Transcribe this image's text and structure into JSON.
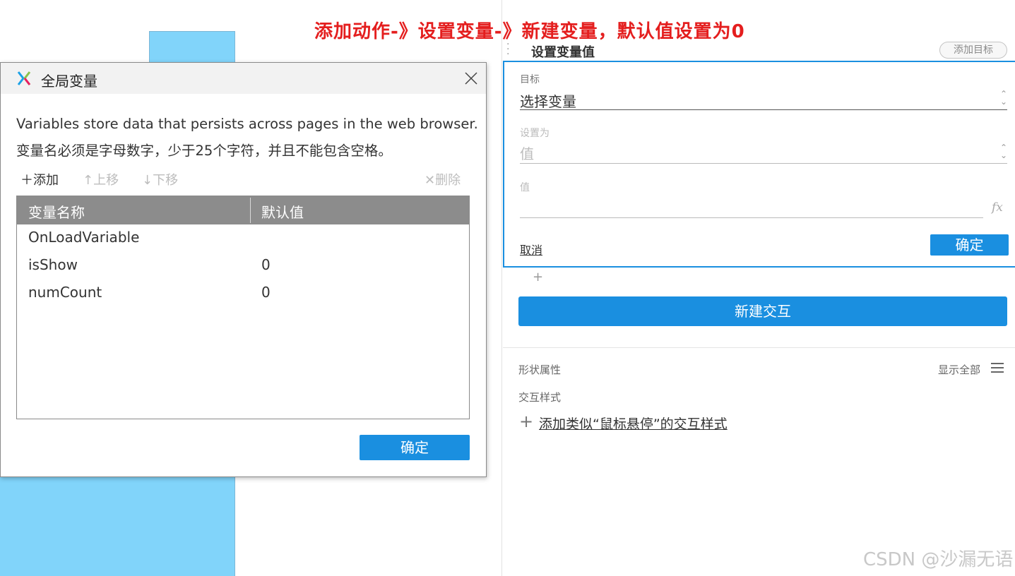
{
  "annotation": "添加动作-》设置变量-》新建变量，默认值设置为0",
  "dialog": {
    "title": "全局变量",
    "description_en": "Variables store data that persists across pages in the web browser.",
    "description_zh": "变量名必须是字母数字，少于25个字符，并且不能包含空格。",
    "toolbar": {
      "add": "＋添加",
      "move_up": "↑上移",
      "move_down": "↓下移",
      "delete": "✕删除"
    },
    "table": {
      "columns": [
        "变量名称",
        "默认值"
      ],
      "rows": [
        {
          "name": "OnLoadVariable",
          "default": ""
        },
        {
          "name": "isShow",
          "default": "0"
        },
        {
          "name": "numCount",
          "default": "0"
        }
      ]
    },
    "ok_label": "确定"
  },
  "action": {
    "title": "设置变量值",
    "add_target_label": "添加目标",
    "target_label": "目标",
    "target_value": "选择变量",
    "set_to_label": "设置为",
    "set_to_value": "值",
    "value_label": "值",
    "value_input": "",
    "fx_icon": "fx",
    "cancel_label": "取消",
    "ok_label": "确定"
  },
  "panel": {
    "add_symbol": "+",
    "new_interaction_label": "新建交互",
    "shape_props_label": "形状属性",
    "show_all_label": "显示全部",
    "interaction_style_label": "交互样式",
    "add_style_plus": "+",
    "add_style_label": "添加类似“鼠标悬停”的交互样式"
  },
  "watermark": "CSDN @沙漏无语",
  "colors": {
    "accent": "#1a8fe0",
    "annotation": "#e41e1e",
    "canvas_shape": "#81d4fa",
    "table_header": "#8c8c8c"
  }
}
